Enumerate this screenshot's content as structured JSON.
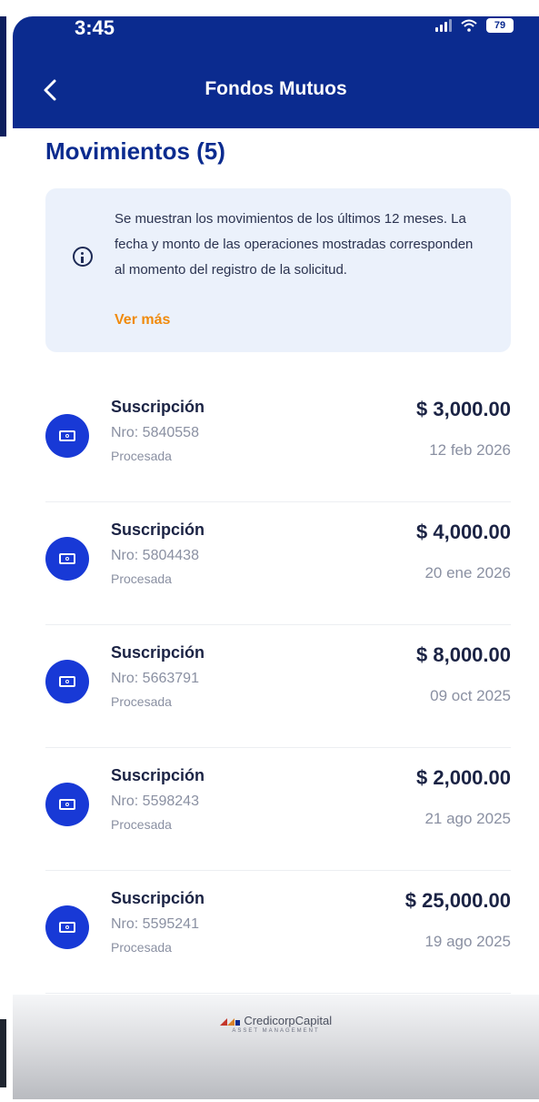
{
  "status_bar": {
    "time": "3:45",
    "battery": "79"
  },
  "header": {
    "title": "Fondos Mutuos",
    "back_icon": "chevron-left-icon"
  },
  "section": {
    "title": "Movimientos (5)"
  },
  "info": {
    "icon": "info-icon",
    "text": "Se muestran los movimientos de los últimos 12 meses. La fecha y monto de las operaciones mostradas corresponden al momento del registro de la solicitud.",
    "link": "Ver más"
  },
  "movements": [
    {
      "type": "Suscripción",
      "nro": "Nro: 5840558",
      "status": "Procesada",
      "amount": "$ 3,000.00",
      "date": "12 feb 2026"
    },
    {
      "type": "Suscripción",
      "nro": "Nro: 5804438",
      "status": "Procesada",
      "amount": "$ 4,000.00",
      "date": "20 ene 2026"
    },
    {
      "type": "Suscripción",
      "nro": "Nro: 5663791",
      "status": "Procesada",
      "amount": "$ 8,000.00",
      "date": "09 oct 2025"
    },
    {
      "type": "Suscripción",
      "nro": "Nro: 5598243",
      "status": "Procesada",
      "amount": "$ 2,000.00",
      "date": "21 ago 2025"
    },
    {
      "type": "Suscripción",
      "nro": "Nro: 5595241",
      "status": "Procesada",
      "amount": "$ 25,000.00",
      "date": "19 ago 2025"
    }
  ],
  "footer": {
    "brand": "CredicorpCapital",
    "brand_sub": "ASSET MANAGEMENT"
  },
  "colors": {
    "header_bg": "#0b2b8f",
    "accent": "#1839d6",
    "link": "#f08a0c",
    "info_bg": "#ebf1fb"
  }
}
